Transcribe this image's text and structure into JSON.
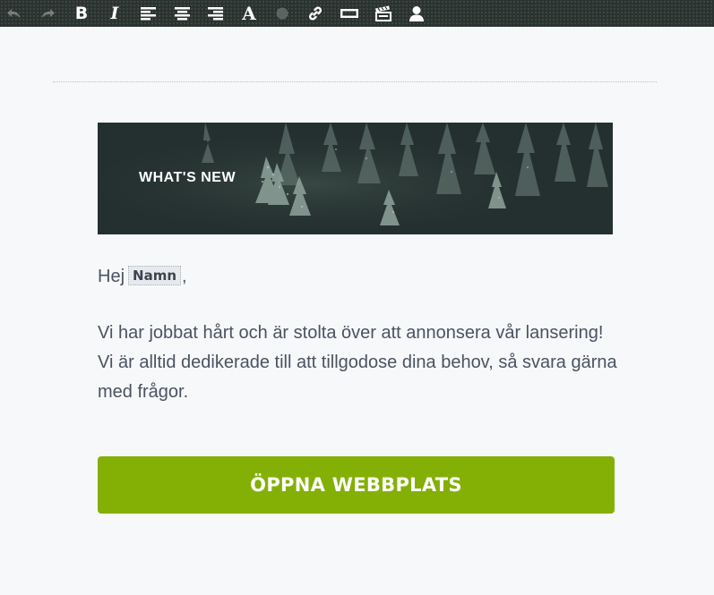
{
  "toolbar": {
    "buttons": [
      {
        "name": "undo",
        "icon": "undo-icon",
        "enabled": false
      },
      {
        "name": "redo",
        "icon": "redo-icon",
        "enabled": false
      },
      {
        "name": "bold",
        "icon": "bold-icon",
        "glyph": "B"
      },
      {
        "name": "italic",
        "icon": "italic-icon",
        "glyph": "I"
      },
      {
        "name": "align-left",
        "icon": "align-left-icon"
      },
      {
        "name": "align-center",
        "icon": "align-center-icon"
      },
      {
        "name": "align-right",
        "icon": "align-right-icon"
      },
      {
        "name": "font",
        "icon": "font-icon",
        "glyph": "A"
      },
      {
        "name": "color",
        "icon": "color-dot-icon"
      },
      {
        "name": "link",
        "icon": "link-icon"
      },
      {
        "name": "button",
        "icon": "button-rectangle-icon"
      },
      {
        "name": "merge-field",
        "icon": "clapperboard-icon"
      },
      {
        "name": "personalize",
        "icon": "person-icon"
      }
    ]
  },
  "banner": {
    "title": "WHAT'S NEW"
  },
  "greeting": {
    "prefix": "Hej",
    "merge_tag": "Namn",
    "suffix": ","
  },
  "body": {
    "text": "Vi har jobbat hårt och är stolta över att annonsera vår lansering! Vi är alltid dedikerade till att tillgodose dina behov, så svara gärna med frågor."
  },
  "cta": {
    "label": "ÖPPNA WEBBPLATS"
  },
  "colors": {
    "toolbar_bg": "#2a332f",
    "canvas_bg": "#f7f8fa",
    "banner_bg": "#24302f",
    "text": "#4a5361",
    "cta_bg": "#84b006",
    "cta_text": "#ffffff"
  }
}
